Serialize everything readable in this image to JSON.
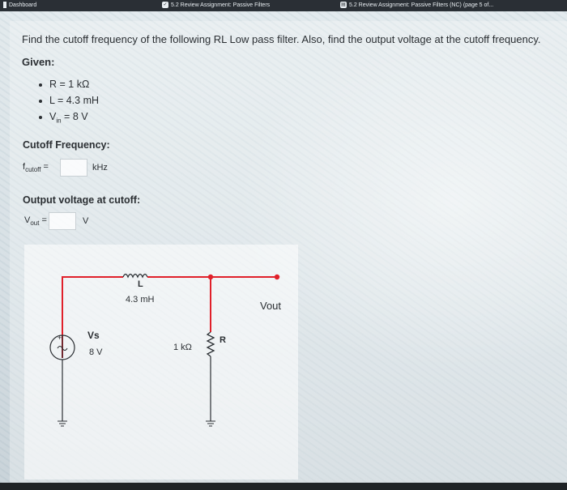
{
  "topbar": {
    "dashboard": "Dashboard",
    "tab_center": "5.2 Review Assignment: Passive Filters",
    "tab_right": "5.2 Review Assignment: Passive Filters (NC) (page 5 of..."
  },
  "question": {
    "text": "Find the cutoff frequency of the following RL Low pass filter. Also, find the output voltage at the cutoff frequency.",
    "given_label": "Given:",
    "given": [
      {
        "text": "R = 1 kΩ"
      },
      {
        "text": "L = 4.3 mH"
      },
      {
        "prefix": "V",
        "sub": "in",
        "suffix": " = 8 V"
      }
    ]
  },
  "cutoff": {
    "heading": "Cutoff Frequency:",
    "label_main": "f",
    "label_sub": "cutoff",
    "label_eq": " =",
    "value": "",
    "unit": "kHz"
  },
  "output": {
    "heading": "Output voltage at cutoff:",
    "label_main": "V",
    "label_sub": "out",
    "label_eq": " =",
    "value": "",
    "unit": "V"
  },
  "circuit": {
    "inductor_name": "L",
    "inductor_value": "4.3 mH",
    "source_name": "Vs",
    "source_value": "8 V",
    "resistor_name": "R",
    "resistor_value": "1 kΩ",
    "output_label": "Vout",
    "wire_color": "#e0202a",
    "component_color": "#2b2f33"
  }
}
